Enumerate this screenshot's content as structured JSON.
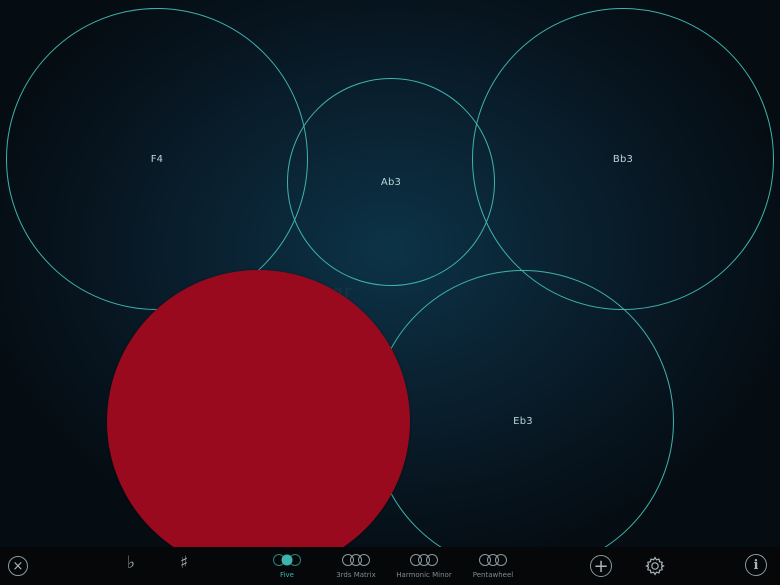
{
  "pads": {
    "f4": "F4",
    "ab3": "Ab3",
    "bb3": "Bb3",
    "eb3": "Eb3"
  },
  "watermark": "Upgr",
  "colors": {
    "active_pad": "#9a0a1e",
    "ring": "#3fb3ad",
    "background": "#07141e"
  },
  "toolbar": {
    "flat_symbol": "♭",
    "sharp_symbol": "♯",
    "layouts": [
      {
        "label": "Five",
        "active": true
      },
      {
        "label": "3rds Matrix",
        "active": false
      },
      {
        "label": "Harmonic Minor",
        "active": false
      },
      {
        "label": "Pentawheel",
        "active": false
      }
    ],
    "icons": {
      "close": "close-icon",
      "add": "plus-icon",
      "settings": "gear-icon",
      "info": "info-icon"
    }
  }
}
